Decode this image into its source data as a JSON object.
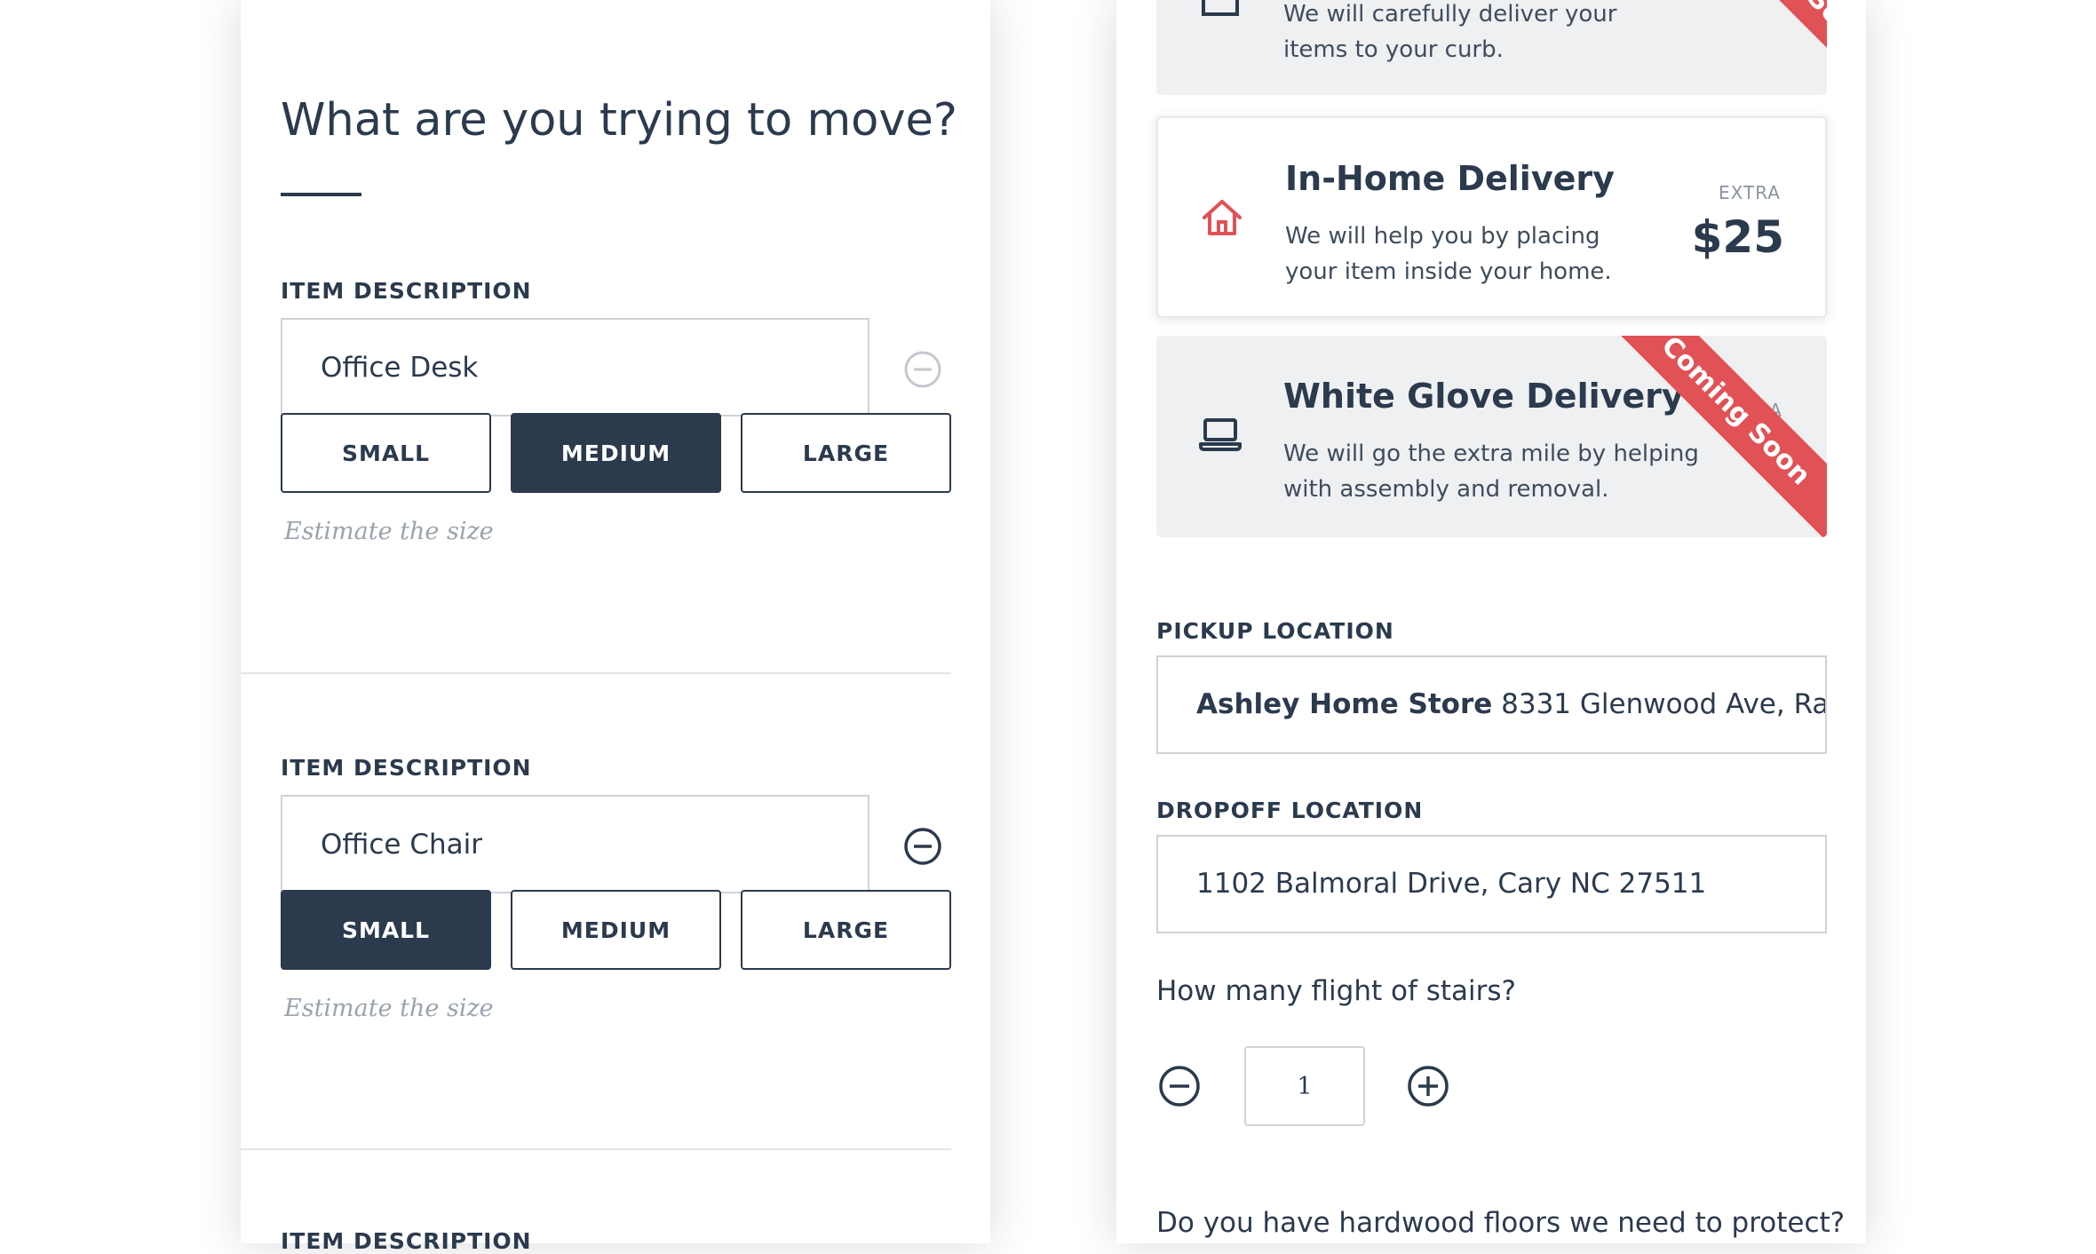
{
  "left_panel": {
    "heading": "What are you trying to move?",
    "items": [
      {
        "label": "ITEM DESCRIPTION",
        "value": "Office Desk",
        "sizes": [
          "SMALL",
          "MEDIUM",
          "LARGE"
        ],
        "selected_size": "MEDIUM",
        "hint": "Estimate the size",
        "remove_enabled": false
      },
      {
        "label": "ITEM DESCRIPTION",
        "value": "Office Chair",
        "sizes": [
          "SMALL",
          "MEDIUM",
          "LARGE"
        ],
        "selected_size": "SMALL",
        "hint": "Estimate the size",
        "remove_enabled": true
      },
      {
        "label": "ITEM DESCRIPTION"
      }
    ]
  },
  "right_panel": {
    "options": [
      {
        "icon": "box-icon",
        "description_lines": [
          "We will carefully deliver your",
          "items to your curb."
        ],
        "ribbon": "Coming Soon",
        "available": false
      },
      {
        "icon": "home-icon",
        "title": "In-Home Delivery",
        "description_lines": [
          "We will help you by placing",
          "your item inside your home."
        ],
        "extra_label": "EXTRA",
        "price": "$25",
        "available": true
      },
      {
        "icon": "laptop-icon",
        "title": "White Glove Delivery",
        "description_lines": [
          "We will go the extra mile by helping",
          "with assembly and removal."
        ],
        "extra_label": "EXTRA",
        "ribbon": "Coming Soon",
        "available": false
      }
    ],
    "pickup": {
      "label": "PICKUP LOCATION",
      "store": "Ashley Home Store",
      "address": "8331 Glenwood Ave, Ra..."
    },
    "dropoff": {
      "label": "DROPOFF LOCATION",
      "value": "1102 Balmoral Drive, Cary NC 27511"
    },
    "stairs": {
      "question": "How many flight of stairs?",
      "value": "1"
    },
    "hardwood_question": "Do you have hardwood floors we need to protect?"
  },
  "colors": {
    "navy": "#2b3a4d",
    "accent_red": "#e05256",
    "border_gray": "#cfd3d8",
    "disabled_card_bg": "#eef0f2",
    "hint_gray": "#9aa3ad"
  }
}
